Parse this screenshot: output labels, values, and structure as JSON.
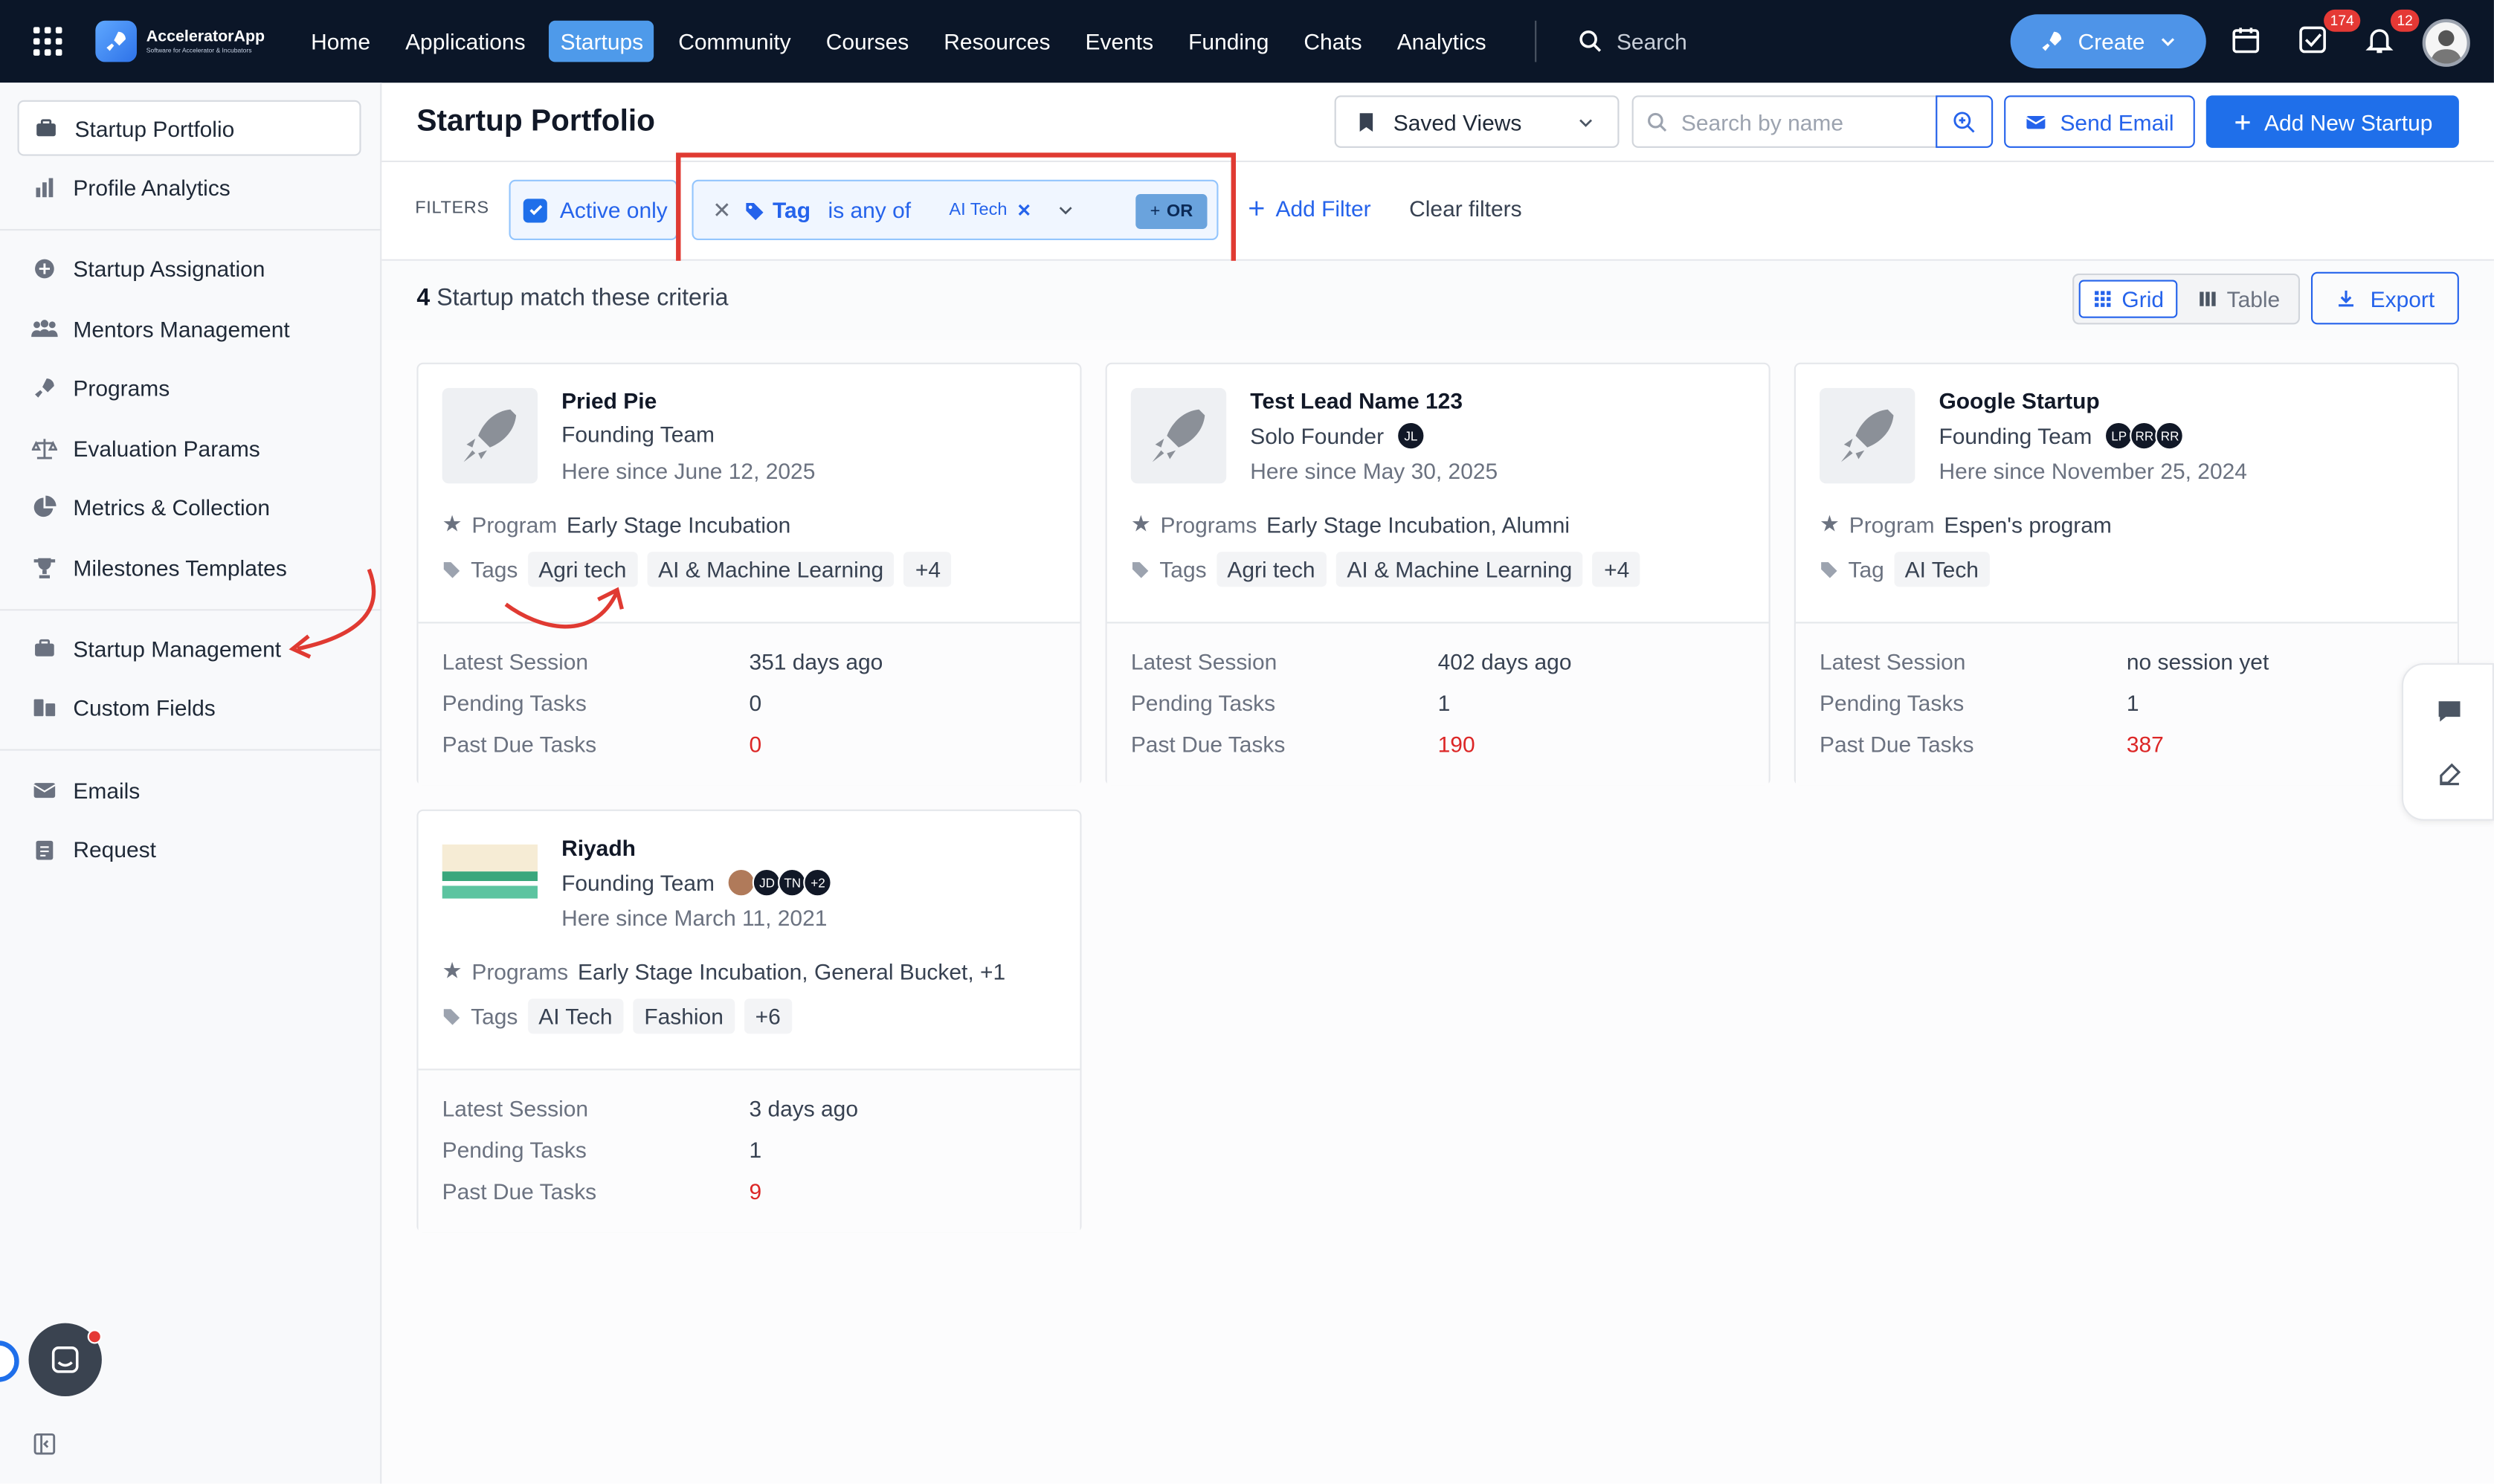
{
  "app": {
    "logo_title": "AcceleratorApp",
    "logo_subtitle": "Software for Accelerator & Incubators"
  },
  "topnav": {
    "links": [
      "Home",
      "Applications",
      "Startups",
      "Community",
      "Courses",
      "Resources",
      "Events",
      "Funding",
      "Chats",
      "Analytics"
    ],
    "active": "Startups",
    "search_placeholder": "Search",
    "create_label": "Create",
    "tasks_badge": "174",
    "notifications_badge": "12"
  },
  "sidebar": {
    "items": [
      {
        "label": "Startup Portfolio",
        "icon": "briefcase-icon",
        "active": true
      },
      {
        "label": "Profile Analytics",
        "icon": "bar-chart-icon"
      },
      {
        "label": "Startup Assignation",
        "icon": "plus-circle-icon"
      },
      {
        "label": "Mentors Management",
        "icon": "users-icon"
      },
      {
        "label": "Programs",
        "icon": "rocket-icon"
      },
      {
        "label": "Evaluation Params",
        "icon": "scale-icon"
      },
      {
        "label": "Metrics & Collection",
        "icon": "pie-chart-icon"
      },
      {
        "label": "Milestones Templates",
        "icon": "trophy-icon"
      },
      {
        "label": "Startup Management",
        "icon": "briefcase-icon"
      },
      {
        "label": "Custom Fields",
        "icon": "fields-icon"
      },
      {
        "label": "Emails",
        "icon": "mail-icon"
      },
      {
        "label": "Request",
        "icon": "clipboard-icon"
      }
    ]
  },
  "header": {
    "title": "Startup Portfolio",
    "saved_views": "Saved Views",
    "search_placeholder": "Search by name",
    "send_email": "Send Email",
    "add_startup": "Add New Startup"
  },
  "filters": {
    "label": "FILTERS",
    "active_only": "Active only",
    "tag_field": "Tag",
    "tag_operator": "is any of",
    "tag_value": "AI Tech",
    "or_label": "OR",
    "add_filter": "Add Filter",
    "clear_filters": "Clear filters"
  },
  "results": {
    "count": "4",
    "count_suffix": "Startup match these criteria",
    "grid_label": "Grid",
    "table_label": "Table",
    "export_label": "Export"
  },
  "stat_labels": {
    "latest": "Latest Session",
    "pending": "Pending Tasks",
    "pastdue": "Past Due Tasks"
  },
  "cards": [
    {
      "name": "Pried Pie",
      "team": "Founding Team",
      "since": "Here since June 12, 2025",
      "program_label": "Program",
      "program": "Early Stage Incubation",
      "tags_label": "Tags",
      "tags": [
        "Agri tech",
        "AI & Machine Learning",
        "+4"
      ],
      "latest": "351 days ago",
      "pending": "0",
      "pastdue": "0"
    },
    {
      "name": "Test Lead Name 123",
      "team": "Solo Founder",
      "avatars": [
        "JL"
      ],
      "since": "Here since May 30, 2025",
      "program_label": "Programs",
      "program": "Early Stage Incubation, Alumni",
      "tags_label": "Tags",
      "tags": [
        "Agri tech",
        "AI & Machine Learning",
        "+4"
      ],
      "latest": "402 days ago",
      "pending": "1",
      "pastdue": "190"
    },
    {
      "name": "Google Startup",
      "team": "Founding Team",
      "avatars": [
        "LP",
        "RR",
        "RR"
      ],
      "since": "Here since November 25, 2024",
      "program_label": "Program",
      "program": "Espen's program",
      "tags_label": "Tag",
      "tags": [
        "AI Tech"
      ],
      "latest": "no session yet",
      "pending": "1",
      "pastdue": "387"
    },
    {
      "name": "Riyadh",
      "team": "Founding Team",
      "avatars": [
        "JD",
        "TN",
        "+2"
      ],
      "since": "Here since March 11, 2021",
      "program_label": "Programs",
      "program": "Early Stage Incubation, General Bucket, +1",
      "tags_label": "Tags",
      "tags": [
        "AI Tech",
        "Fashion",
        "+6"
      ],
      "latest": "3 days ago",
      "pending": "1",
      "pastdue": "9"
    }
  ],
  "colors": {
    "accent": "#1f6fea",
    "nav_bg": "#0b1628",
    "danger": "#dc2626",
    "annotation": "#e03a32"
  }
}
